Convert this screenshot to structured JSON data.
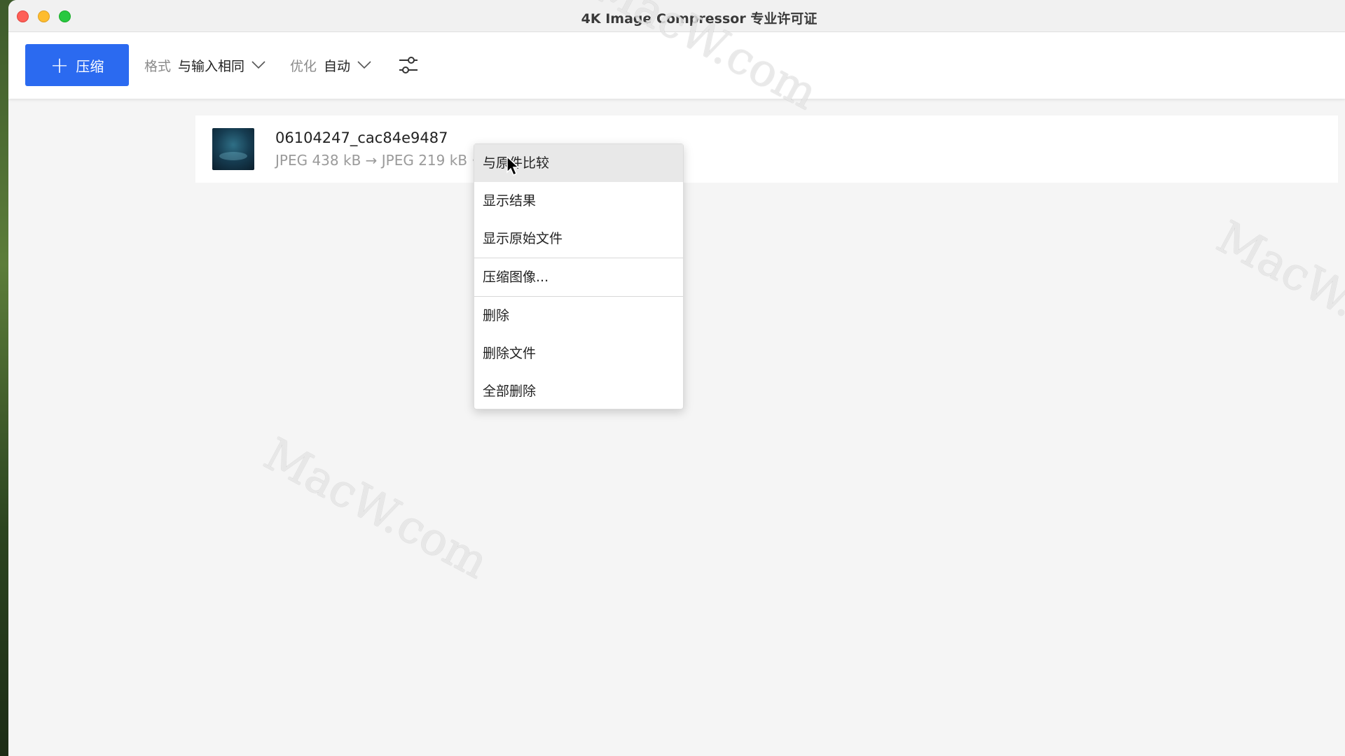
{
  "window": {
    "title": "4K Image Compressor 专业许可证"
  },
  "toolbar": {
    "compress_label": "压缩",
    "format_label": "格式",
    "format_value": "与输入相同",
    "optimize_label": "优化",
    "optimize_value": "自动"
  },
  "file": {
    "name": "06104247_cac84e9487",
    "info": "JPEG 438 kB → JPEG 219 kB ·"
  },
  "context_menu": {
    "items": [
      "与原件比较",
      "显示结果",
      "显示原始文件",
      "压缩图像...",
      "删除",
      "删除文件",
      "全部删除"
    ]
  },
  "watermark": "MacW.com",
  "icons": {
    "compress_button": "plus-icon",
    "dropdown": "chevron-down-icon",
    "settings": "sliders-icon"
  },
  "colors": {
    "accent": "#2b6af0",
    "close": "#fe5f57",
    "minimize": "#febc2e",
    "maximize": "#28c840"
  }
}
